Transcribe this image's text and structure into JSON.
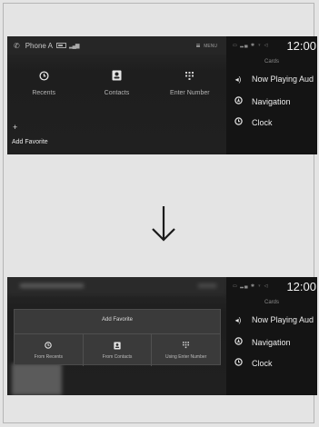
{
  "top_screen": {
    "header": {
      "title": "Phone A",
      "menu_label": "MENU"
    },
    "tiles": [
      {
        "label": "Recents",
        "icon": "clock-icon"
      },
      {
        "label": "Contacts",
        "icon": "contact-icon"
      },
      {
        "label": "Enter Number",
        "icon": "keypad-icon"
      }
    ],
    "add_favorite": "Add Favorite",
    "cards": {
      "time": "12:00",
      "title": "Cards",
      "items": [
        {
          "label": "Now Playing Aud",
          "icon": "speaker-icon"
        },
        {
          "label": "Navigation",
          "icon": "navigation-icon"
        },
        {
          "label": "Clock",
          "icon": "clock-icon"
        }
      ]
    }
  },
  "bottom_screen": {
    "dialog": {
      "title": "Add Favorite",
      "options": [
        {
          "label": "From Recents",
          "icon": "clock-icon"
        },
        {
          "label": "From Contacts",
          "icon": "contact-icon"
        },
        {
          "label": "Using Enter Number",
          "icon": "keypad-icon"
        }
      ]
    },
    "cards": {
      "time": "12:00",
      "title": "Cards",
      "items": [
        {
          "label": "Now Playing Aud",
          "icon": "speaker-icon"
        },
        {
          "label": "Navigation",
          "icon": "navigation-icon"
        },
        {
          "label": "Clock",
          "icon": "clock-icon"
        }
      ]
    }
  }
}
